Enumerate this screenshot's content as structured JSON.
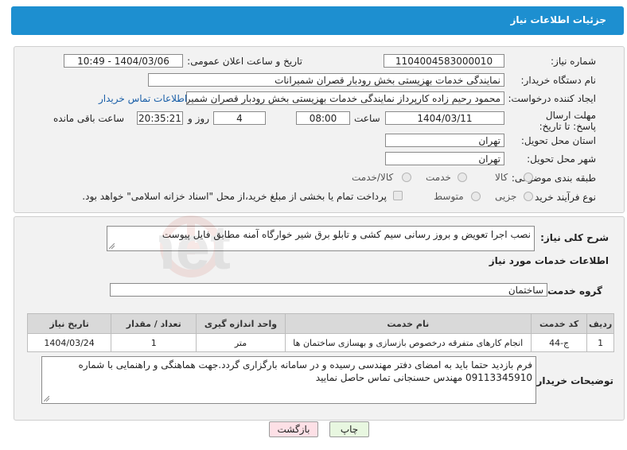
{
  "header": {
    "title": "جزئیات اطلاعات نیاز"
  },
  "form": {
    "need_number": {
      "label": "شماره نیاز:",
      "value": "1104004583000010"
    },
    "announce_datetime": {
      "label": "تاریخ و ساعت اعلان عمومی:",
      "value": "1404/03/06 - 10:49"
    },
    "buyer_org": {
      "label": "نام دستگاه خریدار:",
      "value": "نمایندگی خدمات بهزیستی بخش رودبار قصران   شمیرانات"
    },
    "requester": {
      "label": "ایجاد کننده درخواست:",
      "value": "محمود رحیم زاده کارپرداز نمایندگی خدمات بهزیستی بخش رودبار قصران   شمیر",
      "contact_link": "اطلاعات تماس خریدار"
    },
    "deadline": {
      "label": "مهلت ارسال پاسخ: تا تاریخ:",
      "date": "1404/03/11",
      "time_label": "ساعت",
      "time": "08:00",
      "days": "4",
      "days_label": "روز و",
      "remaining": "20:35:21",
      "remaining_label": "ساعت باقی مانده"
    },
    "delivery_province": {
      "label": "استان محل تحویل:",
      "value": "تهران"
    },
    "delivery_city": {
      "label": "شهر محل تحویل:",
      "value": "تهران"
    },
    "category": {
      "label": "طبقه بندی موضوعی:",
      "options": [
        "کالا",
        "خدمت",
        "کالا/خدمت"
      ]
    },
    "purchase_type": {
      "label": "نوع فرآیند خرید :",
      "options": [
        "جزیی",
        "متوسط"
      ],
      "checkbox_text": "پرداخت تمام یا بخشی از مبلغ خرید،از محل \"اسناد خزانه اسلامی\" خواهد بود."
    }
  },
  "description": {
    "label": "شرح کلی نیاز:",
    "value": "نصب اجرا تعویض و بروز رسانی سیم کشی و تابلو برق شیر خوارگاه آمنه مطابق فایل پیوست"
  },
  "services": {
    "section_title": "اطلاعات خدمات مورد نیاز",
    "group_label": "گروه خدمت:",
    "group_value": "ساختمان",
    "table": {
      "headers": [
        "ردیف",
        "کد خدمت",
        "نام خدمت",
        "واحد اندازه گیری",
        "تعداد / مقدار",
        "تاریخ نیاز"
      ],
      "rows": [
        [
          "1",
          "ج-44",
          "انجام کارهای متفرقه درخصوص بازسازی و بهسازی ساختمان ها",
          "متر",
          "1",
          "1404/03/24"
        ]
      ]
    }
  },
  "buyer_notes": {
    "label": "توضیحات خریدار:",
    "value": "فرم بازدید حتما باید به امضای دفتر مهندسی رسیده و در سامانه بارگزاری گردد.جهت هماهنگی و راهنمایی با شماره 09113345910 مهندس حسنجانی تماس حاصل نمایید"
  },
  "buttons": {
    "print": "چاپ",
    "back": "بازگشت"
  },
  "watermark": {
    "text": "AriaTender.net"
  }
}
